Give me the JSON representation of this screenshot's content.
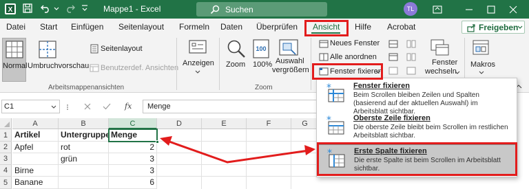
{
  "window": {
    "document_title": "Mappe1 - Excel",
    "search_label": "Suchen",
    "user_initials": "TL"
  },
  "tabs": [
    "Datei",
    "Start",
    "Einfügen",
    "Seitenlayout",
    "Formeln",
    "Daten",
    "Überprüfen",
    "Ansicht",
    "Hilfe",
    "Acrobat"
  ],
  "share_label": "Freigeben",
  "ribbon": {
    "normal": "Normal",
    "umbruch": "Umbruchvorschau",
    "seitenlayout": "Seitenlayout",
    "benutzer": "Benutzerdef. Ansichten",
    "group_ansichten": "Arbeitsmappenansichten",
    "anzeigen": "Anzeigen",
    "zoom": "Zoom",
    "zoom100": "100%",
    "auswahl1": "Auswahl",
    "auswahl2": "vergrößern",
    "group_zoom": "Zoom",
    "neues_fenster": "Neues Fenster",
    "alle_anordnen": "Alle anordnen",
    "fenster_fixieren": "Fenster fixieren",
    "fenster_wechseln1": "Fenster",
    "fenster_wechseln2": "wechseln",
    "makros": "Makros"
  },
  "formula_bar": {
    "name_box": "C1",
    "fx": "fx",
    "content": "Menge"
  },
  "grid": {
    "columns": [
      "A",
      "B",
      "C",
      "D",
      "E",
      "F",
      "G"
    ],
    "rows": [
      {
        "num": "1",
        "a": "Artikel",
        "b": "Untergruppe",
        "c": "Menge"
      },
      {
        "num": "2",
        "a": "Apfel",
        "b": "rot",
        "c": "2"
      },
      {
        "num": "3",
        "a": "",
        "b": "grün",
        "c": "3"
      },
      {
        "num": "4",
        "a": "Birne",
        "b": "",
        "c": "3"
      },
      {
        "num": "5",
        "a": "Banane",
        "b": "",
        "c": "6"
      }
    ]
  },
  "dropdown": [
    {
      "title": "Fenster fixieren",
      "desc": "Beim Scrollen bleiben Zeilen und Spalten (basierend auf der aktuellen Auswahl) im Arbeitsblatt sichtbar."
    },
    {
      "title": "Oberste Zeile fixieren",
      "desc": "Die oberste Zeile bleibt beim Scrollen im restlichen Arbeitsblatt sichtbar."
    },
    {
      "title": "Erste Spalte fixieren",
      "desc": "Die erste Spalte ist beim Scrollen im Arbeitsblatt sichtbar."
    }
  ],
  "colors": {
    "excel_green": "#217346",
    "annotation_red": "#e21c1c"
  }
}
